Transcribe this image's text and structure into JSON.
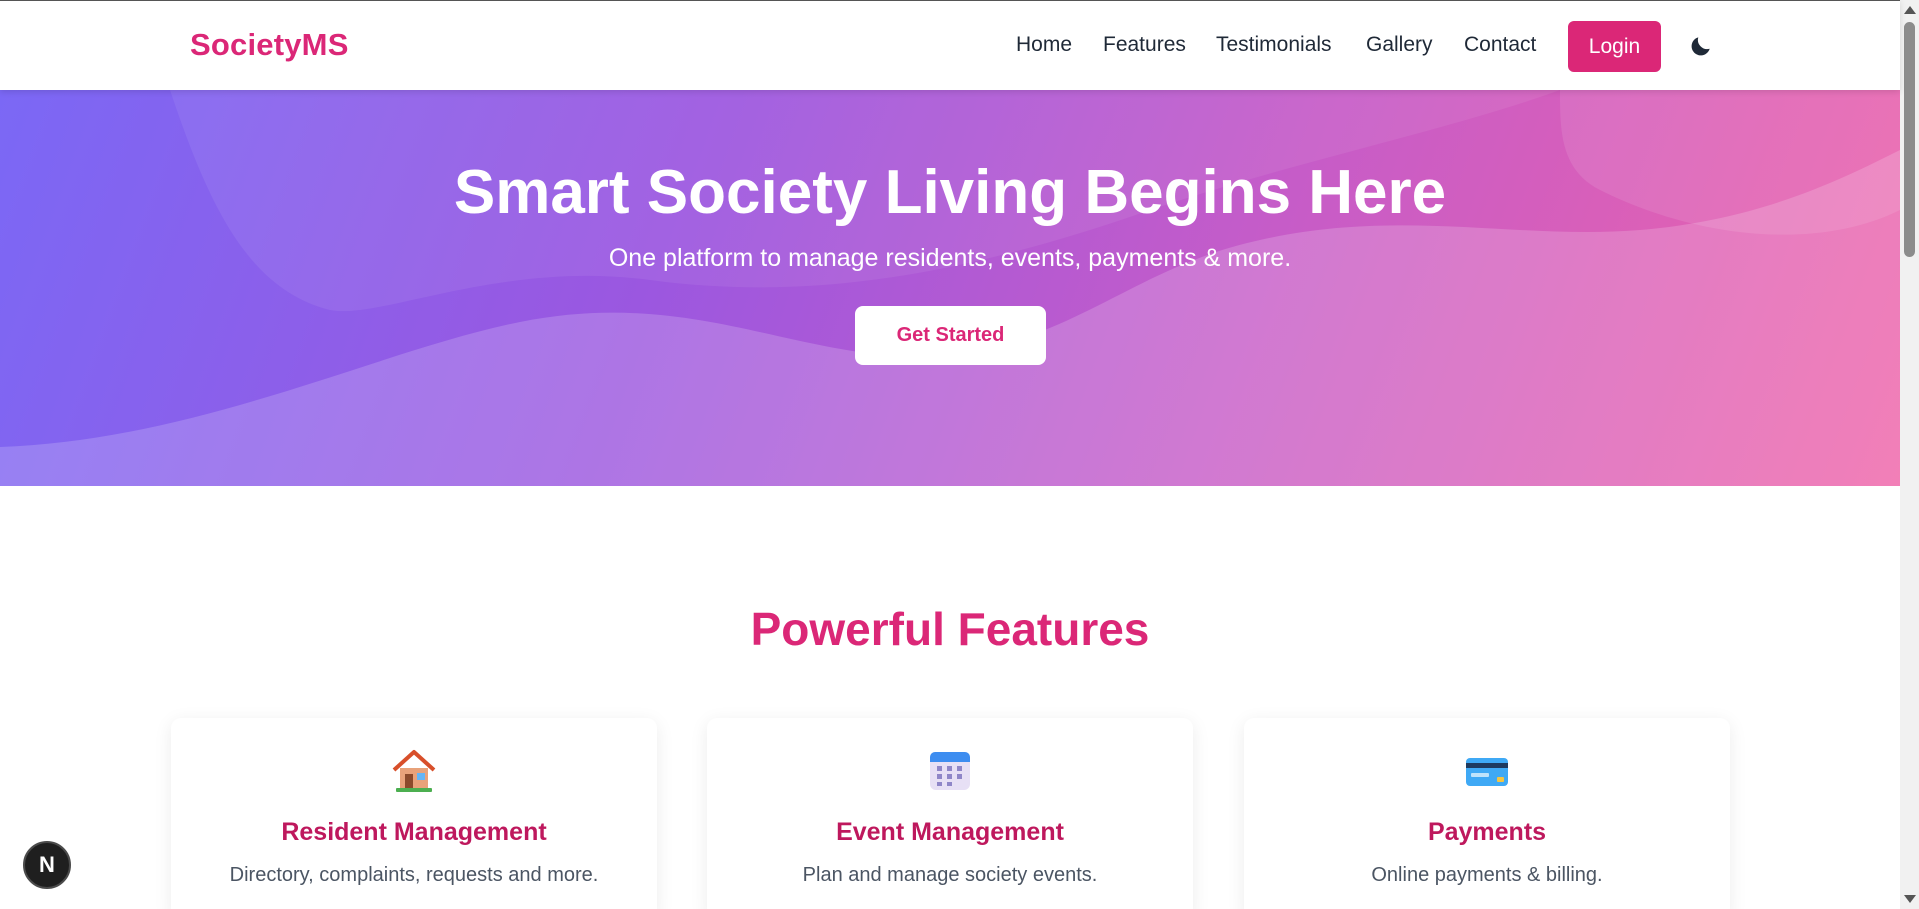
{
  "header": {
    "brand": "SocietyMS",
    "nav": [
      "Home",
      "Features",
      "Testimonials",
      "Gallery",
      "Contact"
    ],
    "login_label": "Login",
    "theme_icon": "moon-icon"
  },
  "hero": {
    "title": "Smart Society Living Begins Here",
    "subtitle": "One platform to manage residents, events, payments & more.",
    "cta_label": "Get Started"
  },
  "features": {
    "title": "Powerful Features",
    "cards": [
      {
        "icon": "house-icon",
        "title": "Resident Management",
        "description": "Directory, complaints, requests and more."
      },
      {
        "icon": "calendar-icon",
        "title": "Event Management",
        "description": "Plan and manage society events."
      },
      {
        "icon": "credit-card-icon",
        "title": "Payments",
        "description": "Online payments & billing."
      }
    ]
  },
  "badge": {
    "label": "N"
  },
  "colors": {
    "brand": "#db2777",
    "card_title": "#be185d",
    "hero_gradient_start": "#7b68f5",
    "hero_gradient_end": "#ef63a8"
  }
}
